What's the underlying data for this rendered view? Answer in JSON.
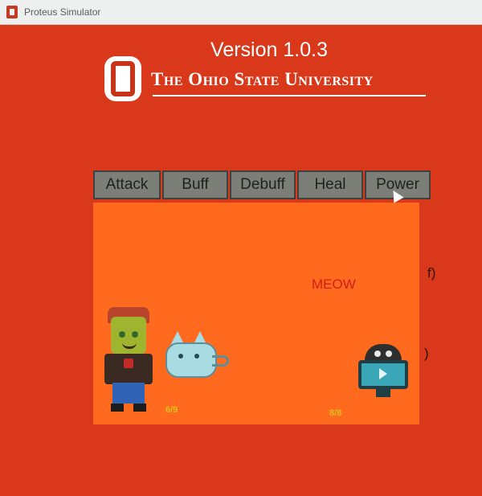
{
  "window": {
    "title": "Proteus Simulator"
  },
  "header": {
    "version": "Version 1.0.3",
    "university": "The Ohio State University"
  },
  "tabs": [
    {
      "label": "Attack"
    },
    {
      "label": "Buff"
    },
    {
      "label": "Debuff"
    },
    {
      "label": "Heal"
    },
    {
      "label": "Power"
    }
  ],
  "arena": {
    "meow": "MEOW",
    "edge_text_1": "f)",
    "edge_text_2": ")",
    "hp_left": "6/9",
    "hp_right": "8/8"
  },
  "icons": {
    "app": "proteus-app-icon",
    "logo": "block-o-logo",
    "player": "player-sprite",
    "pet": "cat-sprite",
    "enemy": "robot-sprite",
    "cursor": "mouse-cursor-icon"
  },
  "colors": {
    "background": "#d9381a",
    "arena": "#ff6a1f",
    "tab": "#7b7f78",
    "meow": "#d21d14"
  }
}
